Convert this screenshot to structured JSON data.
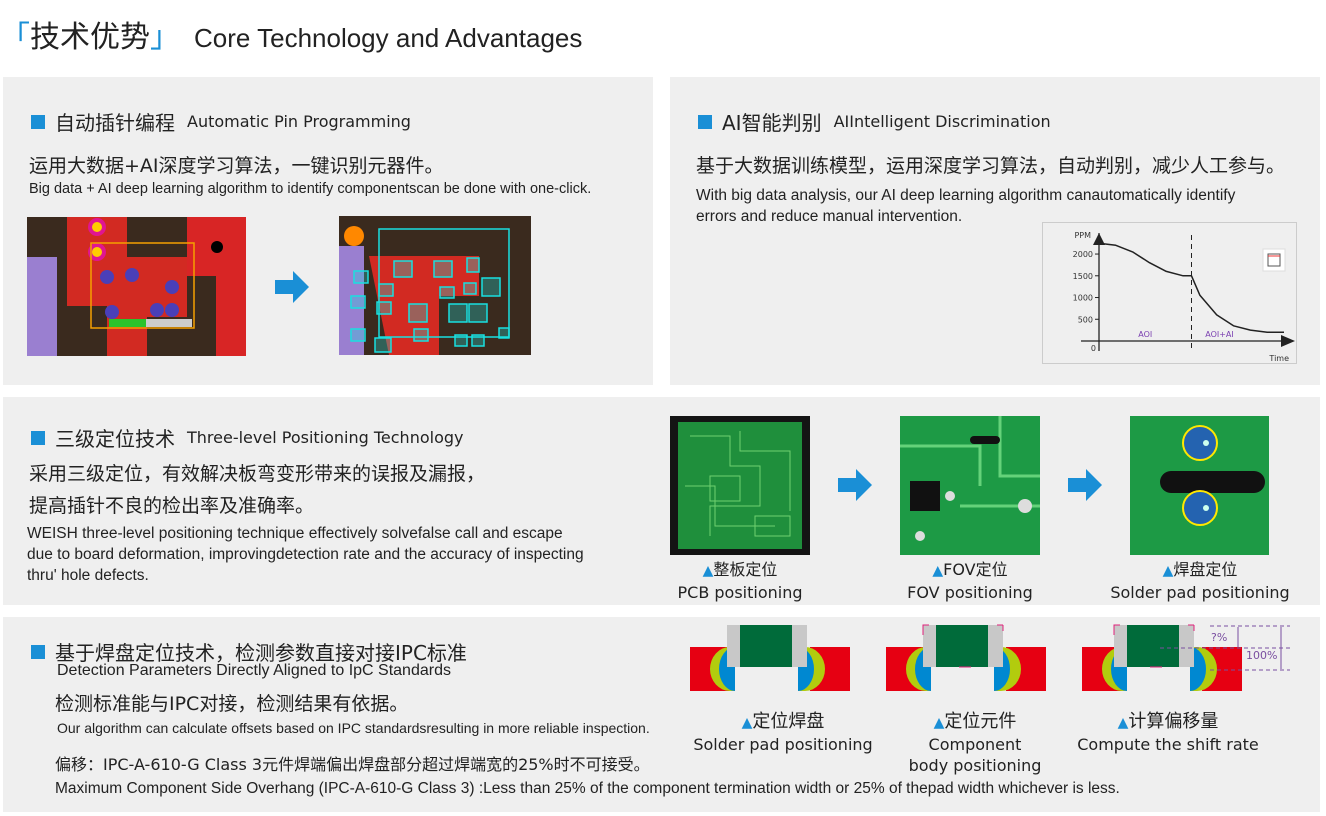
{
  "title": {
    "open": "「",
    "zh": "技术优势",
    "close": "」",
    "en": "Core Technology and Advantages"
  },
  "s1": {
    "title_zh": "自动插针编程",
    "title_en": "Automatic Pin Programming",
    "desc_zh": "运用大数据+AI深度学习算法，一键识别元器件。",
    "desc_en": "Big data + AI deep learning algorithm to identify componentscan be done with one-click.",
    "progress": 0.45
  },
  "s2": {
    "title_zh": "AI智能判别",
    "title_en": "AIIntelligent Discrimination",
    "desc_zh": "基于大数据训练模型，运用深度学习算法，自动判别，减少人工参与。",
    "desc_en_1": "With big data analysis, our AI deep learning algorithm canautomatically identify",
    "desc_en_2": "errors and reduce manual intervention."
  },
  "chart_data": {
    "type": "line",
    "ylabel": "PPM",
    "xlabel": "Time",
    "yticks": [
      "0",
      "500",
      "1000",
      "1500",
      "2000"
    ],
    "ylim": [
      0,
      2300
    ],
    "regions": [
      "AOI",
      "AOI+AI"
    ],
    "x": [
      0,
      1,
      2,
      3,
      4,
      5,
      5.5,
      6,
      7,
      8,
      9,
      10,
      11
    ],
    "values": [
      2250,
      2200,
      2050,
      1800,
      1600,
      1500,
      1500,
      1050,
      600,
      350,
      250,
      200,
      200
    ],
    "divider_x": 5.5,
    "grid": false
  },
  "s3": {
    "title_zh": "三级定位技术",
    "title_en": "Three-level Positioning Technology",
    "desc_zh_1": "采用三级定位，有效解决板弯变形带来的误报及漏报，",
    "desc_zh_2": "提高插针不良的检出率及准确率。",
    "desc_en_1": "WEISH three-level positioning technique effectively solvefalse call and escape",
    "desc_en_2": "due to board deformation, improvingdetection rate and the accuracy of inspecting",
    "desc_en_3": "thru' hole defects.",
    "captions": [
      {
        "zh": "整板定位",
        "en": "PCB positioning"
      },
      {
        "zh": "FOV定位",
        "en": "FOV positioning"
      },
      {
        "zh": "焊盘定位",
        "en": "Solder pad positioning"
      }
    ]
  },
  "s4": {
    "title_zh": "基于焊盘定位技术，检测参数直接对接IPC标准",
    "title_en": "Detection Parameters Directly Aligned to IpC Standards",
    "desc_zh": "检测标准能与IPC对接，检测结果有依据。",
    "desc_en": "Our algorithm can calculate offsets based on IPC standardsresulting in more reliable inspection.",
    "note_zh": "偏移：IPC-A-610-G Class 3元件焊端偏出焊盘部分超过焊端宽的25%时不可接受。",
    "note_en": "Maximum Component Side Overhang (IPC-A-610-G Class 3) :Less than 25% of the component termination width or 25% of thepad width whichever is less.",
    "captions": [
      {
        "zh": "定位焊盘",
        "en": "Solder pad positioning"
      },
      {
        "zh": "定位元件",
        "en": "Component",
        "en2": "body positioning"
      },
      {
        "zh": "计算偏移量",
        "en": "Compute the shift rate"
      }
    ],
    "shift_label": "?%",
    "full_label": "100%"
  },
  "triangle": "▲",
  "colors": {
    "accent": "#1a8fd6",
    "panel": "#efefef",
    "pad": "#e60012",
    "lead": "#0088d1",
    "fillet": "#b2cc0e",
    "body": "#006b3a"
  }
}
